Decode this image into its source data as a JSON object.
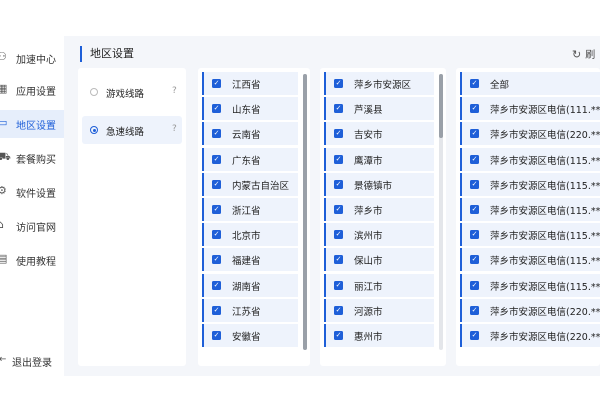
{
  "sidebar": {
    "items": [
      {
        "label": "加速中心",
        "icon": "speed-icon",
        "glyph": "⚇"
      },
      {
        "label": "应用设置",
        "icon": "apps-icon",
        "glyph": "▦"
      },
      {
        "label": "地区设置",
        "icon": "monitor-icon",
        "glyph": "▭",
        "active": true
      },
      {
        "label": "套餐购买",
        "icon": "cart-icon",
        "glyph": "⛟"
      },
      {
        "label": "软件设置",
        "icon": "gear-icon",
        "glyph": "⚙"
      },
      {
        "label": "访问官网",
        "icon": "home-icon",
        "glyph": "⌂"
      },
      {
        "label": "使用教程",
        "icon": "book-icon",
        "glyph": "▤"
      }
    ],
    "logout": {
      "label": "退出登录",
      "icon": "logout-icon",
      "glyph": "⇤"
    }
  },
  "header": {
    "title": "地区设置",
    "refresh_label": "刷",
    "refresh_glyph": "↻"
  },
  "modes": [
    {
      "label": "游戏线路",
      "help": "?",
      "active": false
    },
    {
      "label": "急速线路",
      "help": "?",
      "active": true
    }
  ],
  "provinces": [
    "江西省",
    "山东省",
    "云南省",
    "广东省",
    "内蒙古自治区",
    "浙江省",
    "北京市",
    "福建省",
    "湖南省",
    "江苏省",
    "安徽省"
  ],
  "cities": [
    "萍乡市安源区",
    "芦溪县",
    "吉安市",
    "鹰潭市",
    "景德镇市",
    "萍乡市",
    "滨州市",
    "保山市",
    "丽江市",
    "河源市",
    "惠州市"
  ],
  "servers": [
    "全部",
    "萍乡市安源区电信(111.**",
    "萍乡市安源区电信(220.**",
    "萍乡市安源区电信(115.**",
    "萍乡市安源区电信(115.**",
    "萍乡市安源区电信(115.**",
    "萍乡市安源区电信(115.**",
    "萍乡市安源区电信(115.**",
    "萍乡市安源区电信(115.**",
    "萍乡市安源区电信(220.**",
    "萍乡市安源区电信(220.**"
  ],
  "check_glyph": "✓",
  "colors": {
    "accent": "#1e5fd8",
    "row_bg": "#eef3fc",
    "app_bg": "#f4f6fa"
  }
}
